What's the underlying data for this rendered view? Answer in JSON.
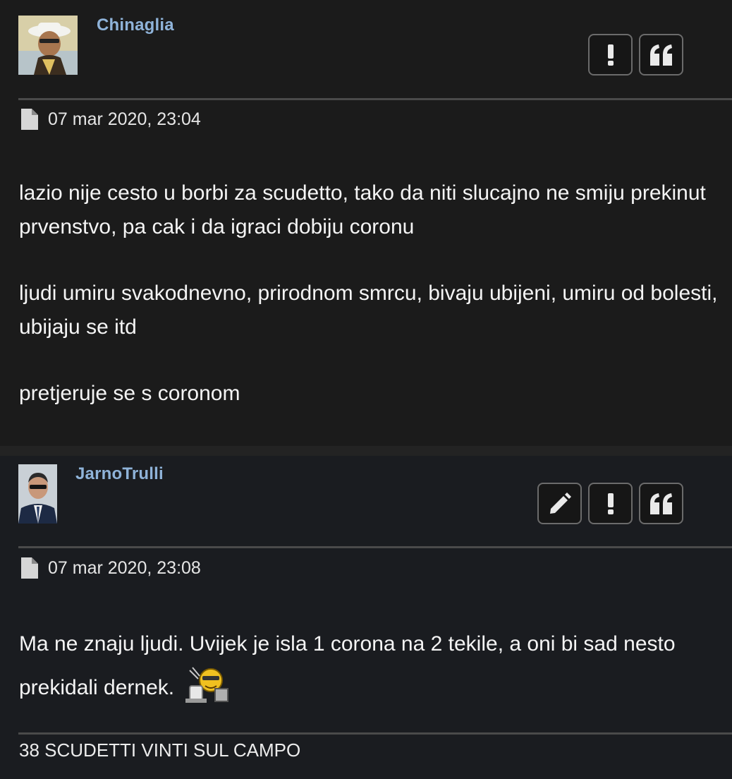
{
  "posts": [
    {
      "username": "Chinaglia",
      "date": "07 mar 2020, 23:04",
      "avatar_icon": "user-avatar-icon",
      "actions": [
        "report-icon",
        "quote-icon"
      ],
      "paragraphs": [
        "lazio nije cesto u borbi za scudetto, tako da niti slucajno ne smiju prekinut prvenstvo, pa cak i da igraci dobiju coronu",
        "ljudi umiru svakodnevno, prirodnom smrcu, bivaju ubijeni, umiru od bolesti, ubijaju se itd",
        "pretjeruje se s coronom"
      ]
    },
    {
      "username": "JarnoTrulli",
      "date": "07 mar 2020, 23:08",
      "avatar_icon": "user-avatar-icon",
      "actions": [
        "edit-icon",
        "report-icon",
        "quote-icon"
      ],
      "text": "Ma ne znaju ljudi. Uvijek je isla 1 corona na 2 tekile, a oni bi sad nesto prekidali dernek.",
      "smiley_icon": "drinking-smiley-icon",
      "signature": "38 SCUDETTI VINTI SUL CAMPO"
    }
  ],
  "colors": {
    "username": "#8fb3d9",
    "background": "#1b1b1b",
    "button_border": "#6b6b6b"
  }
}
